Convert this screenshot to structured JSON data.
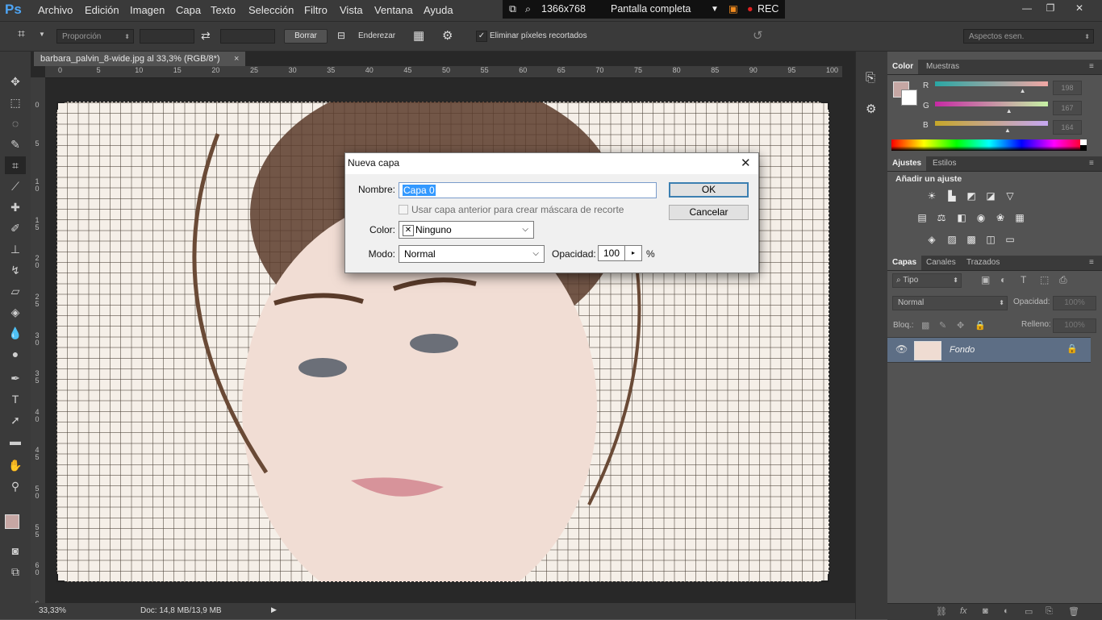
{
  "app": {
    "logo": "Ps"
  },
  "menu": [
    "Archivo",
    "Edición",
    "Imagen",
    "Capa",
    "Texto",
    "Selección",
    "Filtro",
    "Vista",
    "Ventana",
    "Ayuda"
  ],
  "recorder": {
    "resolution": "1366x768",
    "mode": "Pantalla completa",
    "rec_label": "REC"
  },
  "options_bar": {
    "ratio": "Proporción",
    "clear_button": "Borrar",
    "straighten_label": "Enderezar",
    "delete_cropped_label": "Eliminar píxeles recortados",
    "delete_cropped_checked": true,
    "workspace": "Aspectos esen."
  },
  "document": {
    "tab_title": "barbara_palvin_8-wide.jpg al 33,3% (RGB/8*)",
    "ruler_top": [
      "0",
      "5",
      "10",
      "15",
      "20",
      "25",
      "30",
      "35",
      "40",
      "45",
      "50",
      "55",
      "60",
      "65",
      "70",
      "75",
      "80",
      "85",
      "90",
      "95",
      "100"
    ],
    "ruler_left": [
      "0",
      "5",
      "1 0",
      "1 5",
      "2 0",
      "2 5",
      "3 0",
      "3 5",
      "4 0",
      "4 5",
      "5 0",
      "5 5",
      "6 0",
      "6"
    ]
  },
  "status": {
    "zoom": "33,33%",
    "doc_info": "Doc: 14,8 MB/13,9 MB"
  },
  "color_panel": {
    "tabs": [
      "Color",
      "Muestras"
    ],
    "channels": [
      {
        "name": "R",
        "value": "198",
        "level": 0.776
      },
      {
        "name": "G",
        "value": "167",
        "level": 0.655
      },
      {
        "name": "B",
        "value": "164",
        "level": 0.643
      }
    ],
    "foreground": "#c6a7a4"
  },
  "adjustments_panel": {
    "tabs": [
      "Ajustes",
      "Estilos"
    ],
    "heading": "Añadir un ajuste"
  },
  "layers_panel": {
    "tabs": [
      "Capas",
      "Canales",
      "Trazados"
    ],
    "filter_kind": "Tipo",
    "blend_mode": "Normal",
    "opacity_label": "Opacidad:",
    "opacity_value": "100%",
    "lock_label": "Bloq.:",
    "fill_label": "Relleno:",
    "fill_value": "100%",
    "layers": [
      {
        "name": "Fondo",
        "visible": true,
        "locked": true
      }
    ]
  },
  "dialog": {
    "title": "Nueva capa",
    "name_label": "Nombre:",
    "name_value": "Capa 0",
    "clip_label": "Usar capa anterior para crear máscara de recorte",
    "color_label": "Color:",
    "color_value": "Ninguno",
    "mode_label": "Modo:",
    "mode_value": "Normal",
    "opacity_label": "Opacidad:",
    "opacity_value": "100",
    "opacity_unit": "%",
    "ok": "OK",
    "cancel": "Cancelar"
  }
}
